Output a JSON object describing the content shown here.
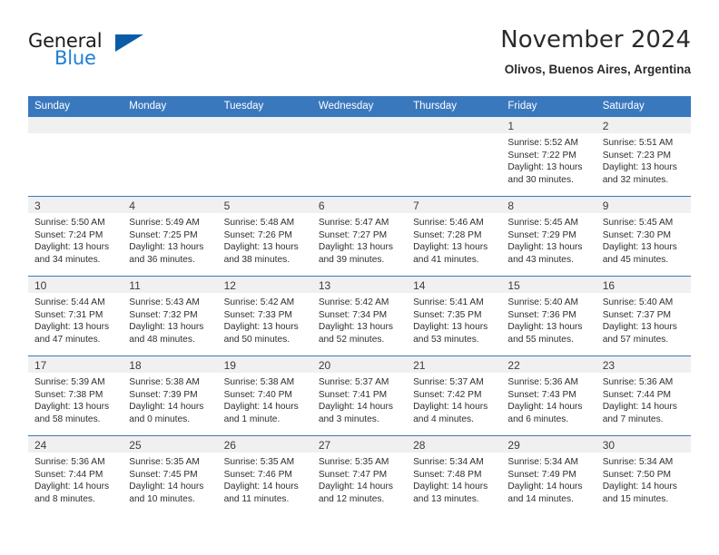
{
  "brand": {
    "name_part1": "General",
    "name_part2": "Blue",
    "triangle_icon": "triangle-icon",
    "accent_color": "#1e7fd4",
    "triangle_color": "#0a5ca8"
  },
  "header": {
    "title": "November 2024",
    "location": "Olivos, Buenos Aires, Argentina"
  },
  "colors": {
    "header_bar": "#3a78be",
    "daynum_band": "#f0f0f0",
    "row_divider": "#3a78be",
    "text": "#2e2e2e"
  },
  "weekday_headers": [
    "Sunday",
    "Monday",
    "Tuesday",
    "Wednesday",
    "Thursday",
    "Friday",
    "Saturday"
  ],
  "weeks": [
    [
      {
        "day": "",
        "empty": true,
        "sunrise": "",
        "sunset": "",
        "daylight_line1": "",
        "daylight_line2": ""
      },
      {
        "day": "",
        "empty": true,
        "sunrise": "",
        "sunset": "",
        "daylight_line1": "",
        "daylight_line2": ""
      },
      {
        "day": "",
        "empty": true,
        "sunrise": "",
        "sunset": "",
        "daylight_line1": "",
        "daylight_line2": ""
      },
      {
        "day": "",
        "empty": true,
        "sunrise": "",
        "sunset": "",
        "daylight_line1": "",
        "daylight_line2": ""
      },
      {
        "day": "",
        "empty": true,
        "sunrise": "",
        "sunset": "",
        "daylight_line1": "",
        "daylight_line2": ""
      },
      {
        "day": "1",
        "sunrise": "Sunrise: 5:52 AM",
        "sunset": "Sunset: 7:22 PM",
        "daylight_line1": "Daylight: 13 hours",
        "daylight_line2": "and 30 minutes."
      },
      {
        "day": "2",
        "sunrise": "Sunrise: 5:51 AM",
        "sunset": "Sunset: 7:23 PM",
        "daylight_line1": "Daylight: 13 hours",
        "daylight_line2": "and 32 minutes."
      }
    ],
    [
      {
        "day": "3",
        "sunrise": "Sunrise: 5:50 AM",
        "sunset": "Sunset: 7:24 PM",
        "daylight_line1": "Daylight: 13 hours",
        "daylight_line2": "and 34 minutes."
      },
      {
        "day": "4",
        "sunrise": "Sunrise: 5:49 AM",
        "sunset": "Sunset: 7:25 PM",
        "daylight_line1": "Daylight: 13 hours",
        "daylight_line2": "and 36 minutes."
      },
      {
        "day": "5",
        "sunrise": "Sunrise: 5:48 AM",
        "sunset": "Sunset: 7:26 PM",
        "daylight_line1": "Daylight: 13 hours",
        "daylight_line2": "and 38 minutes."
      },
      {
        "day": "6",
        "sunrise": "Sunrise: 5:47 AM",
        "sunset": "Sunset: 7:27 PM",
        "daylight_line1": "Daylight: 13 hours",
        "daylight_line2": "and 39 minutes."
      },
      {
        "day": "7",
        "sunrise": "Sunrise: 5:46 AM",
        "sunset": "Sunset: 7:28 PM",
        "daylight_line1": "Daylight: 13 hours",
        "daylight_line2": "and 41 minutes."
      },
      {
        "day": "8",
        "sunrise": "Sunrise: 5:45 AM",
        "sunset": "Sunset: 7:29 PM",
        "daylight_line1": "Daylight: 13 hours",
        "daylight_line2": "and 43 minutes."
      },
      {
        "day": "9",
        "sunrise": "Sunrise: 5:45 AM",
        "sunset": "Sunset: 7:30 PM",
        "daylight_line1": "Daylight: 13 hours",
        "daylight_line2": "and 45 minutes."
      }
    ],
    [
      {
        "day": "10",
        "sunrise": "Sunrise: 5:44 AM",
        "sunset": "Sunset: 7:31 PM",
        "daylight_line1": "Daylight: 13 hours",
        "daylight_line2": "and 47 minutes."
      },
      {
        "day": "11",
        "sunrise": "Sunrise: 5:43 AM",
        "sunset": "Sunset: 7:32 PM",
        "daylight_line1": "Daylight: 13 hours",
        "daylight_line2": "and 48 minutes."
      },
      {
        "day": "12",
        "sunrise": "Sunrise: 5:42 AM",
        "sunset": "Sunset: 7:33 PM",
        "daylight_line1": "Daylight: 13 hours",
        "daylight_line2": "and 50 minutes."
      },
      {
        "day": "13",
        "sunrise": "Sunrise: 5:42 AM",
        "sunset": "Sunset: 7:34 PM",
        "daylight_line1": "Daylight: 13 hours",
        "daylight_line2": "and 52 minutes."
      },
      {
        "day": "14",
        "sunrise": "Sunrise: 5:41 AM",
        "sunset": "Sunset: 7:35 PM",
        "daylight_line1": "Daylight: 13 hours",
        "daylight_line2": "and 53 minutes."
      },
      {
        "day": "15",
        "sunrise": "Sunrise: 5:40 AM",
        "sunset": "Sunset: 7:36 PM",
        "daylight_line1": "Daylight: 13 hours",
        "daylight_line2": "and 55 minutes."
      },
      {
        "day": "16",
        "sunrise": "Sunrise: 5:40 AM",
        "sunset": "Sunset: 7:37 PM",
        "daylight_line1": "Daylight: 13 hours",
        "daylight_line2": "and 57 minutes."
      }
    ],
    [
      {
        "day": "17",
        "sunrise": "Sunrise: 5:39 AM",
        "sunset": "Sunset: 7:38 PM",
        "daylight_line1": "Daylight: 13 hours",
        "daylight_line2": "and 58 minutes."
      },
      {
        "day": "18",
        "sunrise": "Sunrise: 5:38 AM",
        "sunset": "Sunset: 7:39 PM",
        "daylight_line1": "Daylight: 14 hours",
        "daylight_line2": "and 0 minutes."
      },
      {
        "day": "19",
        "sunrise": "Sunrise: 5:38 AM",
        "sunset": "Sunset: 7:40 PM",
        "daylight_line1": "Daylight: 14 hours",
        "daylight_line2": "and 1 minute."
      },
      {
        "day": "20",
        "sunrise": "Sunrise: 5:37 AM",
        "sunset": "Sunset: 7:41 PM",
        "daylight_line1": "Daylight: 14 hours",
        "daylight_line2": "and 3 minutes."
      },
      {
        "day": "21",
        "sunrise": "Sunrise: 5:37 AM",
        "sunset": "Sunset: 7:42 PM",
        "daylight_line1": "Daylight: 14 hours",
        "daylight_line2": "and 4 minutes."
      },
      {
        "day": "22",
        "sunrise": "Sunrise: 5:36 AM",
        "sunset": "Sunset: 7:43 PM",
        "daylight_line1": "Daylight: 14 hours",
        "daylight_line2": "and 6 minutes."
      },
      {
        "day": "23",
        "sunrise": "Sunrise: 5:36 AM",
        "sunset": "Sunset: 7:44 PM",
        "daylight_line1": "Daylight: 14 hours",
        "daylight_line2": "and 7 minutes."
      }
    ],
    [
      {
        "day": "24",
        "sunrise": "Sunrise: 5:36 AM",
        "sunset": "Sunset: 7:44 PM",
        "daylight_line1": "Daylight: 14 hours",
        "daylight_line2": "and 8 minutes."
      },
      {
        "day": "25",
        "sunrise": "Sunrise: 5:35 AM",
        "sunset": "Sunset: 7:45 PM",
        "daylight_line1": "Daylight: 14 hours",
        "daylight_line2": "and 10 minutes."
      },
      {
        "day": "26",
        "sunrise": "Sunrise: 5:35 AM",
        "sunset": "Sunset: 7:46 PM",
        "daylight_line1": "Daylight: 14 hours",
        "daylight_line2": "and 11 minutes."
      },
      {
        "day": "27",
        "sunrise": "Sunrise: 5:35 AM",
        "sunset": "Sunset: 7:47 PM",
        "daylight_line1": "Daylight: 14 hours",
        "daylight_line2": "and 12 minutes."
      },
      {
        "day": "28",
        "sunrise": "Sunrise: 5:34 AM",
        "sunset": "Sunset: 7:48 PM",
        "daylight_line1": "Daylight: 14 hours",
        "daylight_line2": "and 13 minutes."
      },
      {
        "day": "29",
        "sunrise": "Sunrise: 5:34 AM",
        "sunset": "Sunset: 7:49 PM",
        "daylight_line1": "Daylight: 14 hours",
        "daylight_line2": "and 14 minutes."
      },
      {
        "day": "30",
        "sunrise": "Sunrise: 5:34 AM",
        "sunset": "Sunset: 7:50 PM",
        "daylight_line1": "Daylight: 14 hours",
        "daylight_line2": "and 15 minutes."
      }
    ]
  ]
}
